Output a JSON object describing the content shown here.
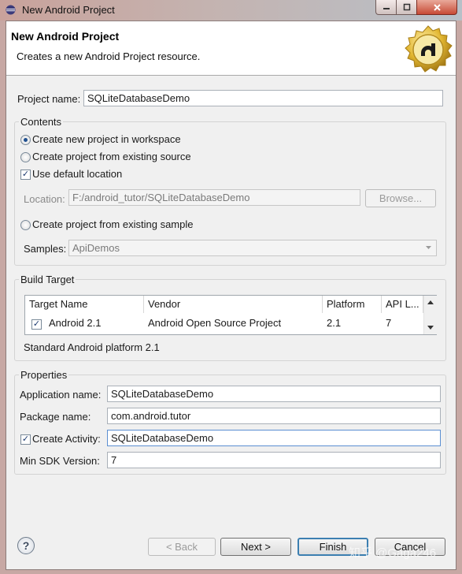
{
  "window": {
    "title": "New Android Project"
  },
  "banner": {
    "title": "New Android Project",
    "description": "Creates a new Android Project resource."
  },
  "project_name": {
    "label": "Project name:",
    "value": "SQLiteDatabaseDemo"
  },
  "contents": {
    "group_label": "Contents",
    "option_new": "Create new project in workspace",
    "option_existing_source": "Create project from existing source",
    "use_default_location": "Use default location",
    "location_label": "Location:",
    "location_value": "F:/android_tutor/SQLiteDatabaseDemo",
    "browse_label": "Browse...",
    "option_existing_sample": "Create project from existing sample",
    "samples_label": "Samples:",
    "samples_value": "ApiDemos"
  },
  "build_target": {
    "group_label": "Build Target",
    "columns": [
      "Target Name",
      "Vendor",
      "Platform",
      "API L..."
    ],
    "rows": [
      {
        "name": "Android 2.1",
        "vendor": "Android Open Source Project",
        "platform": "2.1",
        "api": "7",
        "checked": true
      }
    ],
    "description": "Standard Android platform 2.1"
  },
  "properties": {
    "group_label": "Properties",
    "app_name_label": "Application name:",
    "app_name_value": "SQLiteDatabaseDemo",
    "package_label": "Package name:",
    "package_value": "com.android.tutor",
    "create_activity_label": "Create Activity:",
    "create_activity_value": "SQLiteDatabaseDemo",
    "min_sdk_label": "Min SDK Version:",
    "min_sdk_value": "7"
  },
  "buttons": {
    "back": "< Back",
    "next": "Next >",
    "finish": "Finish",
    "cancel": "Cancel"
  },
  "watermark": "知乎 @Gaga246",
  "colors": {
    "title_bar": "#c9a29b",
    "dialog_bg": "#f0f0f0",
    "default_button_border": "#3c7fb1",
    "logo_gold": "#e2b630"
  }
}
